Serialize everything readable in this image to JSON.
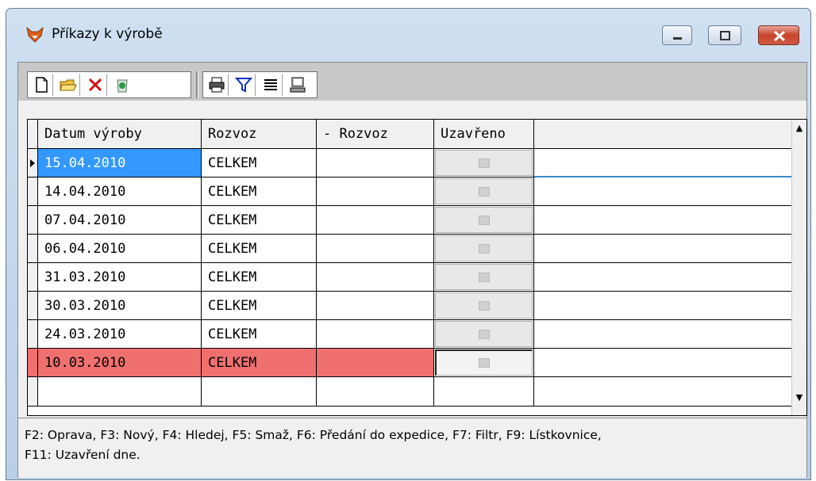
{
  "window": {
    "title": "Příkazy k výrobě"
  },
  "toolbar": {
    "buttons": [
      "new-document",
      "open-folder",
      "delete",
      "recycle",
      "print",
      "filter",
      "list",
      "computer"
    ]
  },
  "grid": {
    "columns": [
      "Datum výroby",
      "Rozvoz",
      "- Rozvoz",
      "Uzavřeno",
      ""
    ],
    "rows": [
      {
        "date": "15.04.2010",
        "rozvoz": "CELKEM",
        "minus_rozvoz": "",
        "uzavreno": false,
        "state": "current"
      },
      {
        "date": "14.04.2010",
        "rozvoz": "CELKEM",
        "minus_rozvoz": "",
        "uzavreno": false,
        "state": "normal"
      },
      {
        "date": "07.04.2010",
        "rozvoz": "CELKEM",
        "minus_rozvoz": "",
        "uzavreno": false,
        "state": "normal"
      },
      {
        "date": "06.04.2010",
        "rozvoz": "CELKEM",
        "minus_rozvoz": "",
        "uzavreno": false,
        "state": "normal"
      },
      {
        "date": "31.03.2010",
        "rozvoz": "CELKEM",
        "minus_rozvoz": "",
        "uzavreno": false,
        "state": "normal"
      },
      {
        "date": "30.03.2010",
        "rozvoz": "CELKEM",
        "minus_rozvoz": "",
        "uzavreno": false,
        "state": "normal"
      },
      {
        "date": "24.03.2010",
        "rozvoz": "CELKEM",
        "minus_rozvoz": "",
        "uzavreno": false,
        "state": "normal"
      },
      {
        "date": "10.03.2010",
        "rozvoz": "CELKEM",
        "minus_rozvoz": "",
        "uzavreno": true,
        "state": "highlighted"
      }
    ]
  },
  "status": {
    "line1": "F2: Oprava, F3: Nový, F4: Hledej, F5: Smaž, F6: Předání do expedice, F7: Filtr, F9: Lístkovnice,",
    "line2": "F11: Uzavření dne."
  },
  "colors": {
    "selected_cell": "#3399ff",
    "highlight_row": "#f07070",
    "title_bar": "#c4d7ee",
    "close_button": "#c7432b"
  }
}
